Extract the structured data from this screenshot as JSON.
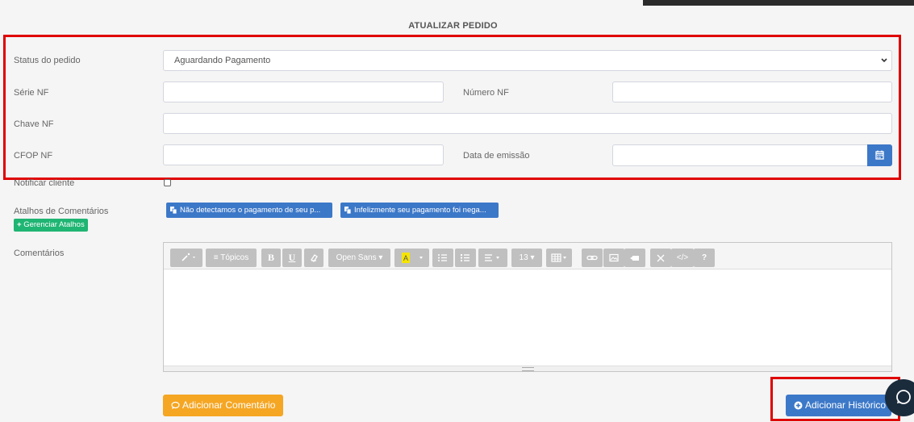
{
  "section_title": "ATUALIZAR PEDIDO",
  "form": {
    "status_label": "Status do pedido",
    "status_value": "Aguardando Pagamento",
    "serie_label": "Série NF",
    "serie_value": "",
    "numero_label": "Número NF",
    "numero_value": "",
    "chave_label": "Chave NF",
    "chave_value": "",
    "cfop_label": "CFOP NF",
    "cfop_value": "",
    "data_label": "Data de emissão",
    "data_value": "",
    "notify_label": "Notificar cliente",
    "notify_checked": false
  },
  "shortcuts": {
    "label": "Atalhos de Comentários",
    "manage_label": "Gerenciar Atalhos",
    "items": [
      "Não detectamos o pagamento de seu p...",
      "Infelizmente seu pagamento foi nega..."
    ]
  },
  "comments": {
    "label": "Comentários",
    "toolbar": {
      "topics": "Tópicos",
      "font": "Open Sans",
      "size": "13",
      "bold": "B",
      "underline": "U",
      "code": "</>",
      "help": "?"
    }
  },
  "buttons": {
    "add_comment": "Adicionar Comentário",
    "add_history": "Adicionar Histórico"
  },
  "colors": {
    "primary": "#3c78c8",
    "success": "#1fb573",
    "warning": "#f5a623",
    "highlight": "#e00000"
  }
}
